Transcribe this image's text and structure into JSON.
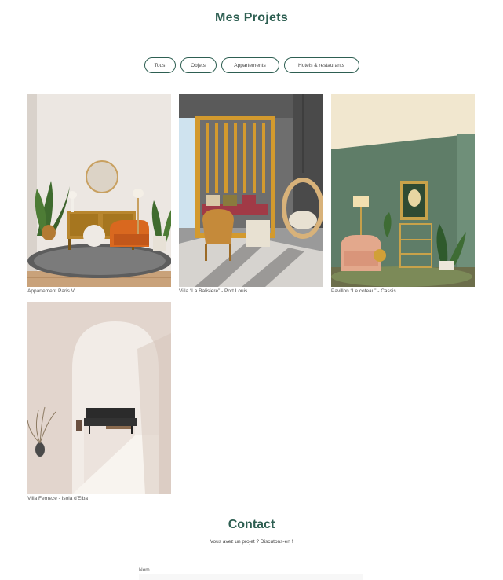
{
  "header": {
    "title": "Mes Projets"
  },
  "filters": [
    {
      "label": "Tous"
    },
    {
      "label": "Objets"
    },
    {
      "label": "Appartements"
    },
    {
      "label": "Hotels & restaurants"
    }
  ],
  "projects": [
    {
      "caption": "Appartement Paris V",
      "image": "living-room-photo"
    },
    {
      "caption": "Villa “La Balisiere” - Port Louis",
      "image": "patio-lounge-photo"
    },
    {
      "caption": "Pavillon “Le coteau” - Cassis",
      "image": "green-salon-photo"
    },
    {
      "caption": "Villa Ferneze - Isola d'Elba",
      "image": "arched-hallway-photo"
    }
  ],
  "contact": {
    "title": "Contact",
    "subtitle": "Vous avez un projet ? Discutons-en !",
    "name_label": "Nom"
  },
  "colors": {
    "accent": "#2e5f52"
  }
}
